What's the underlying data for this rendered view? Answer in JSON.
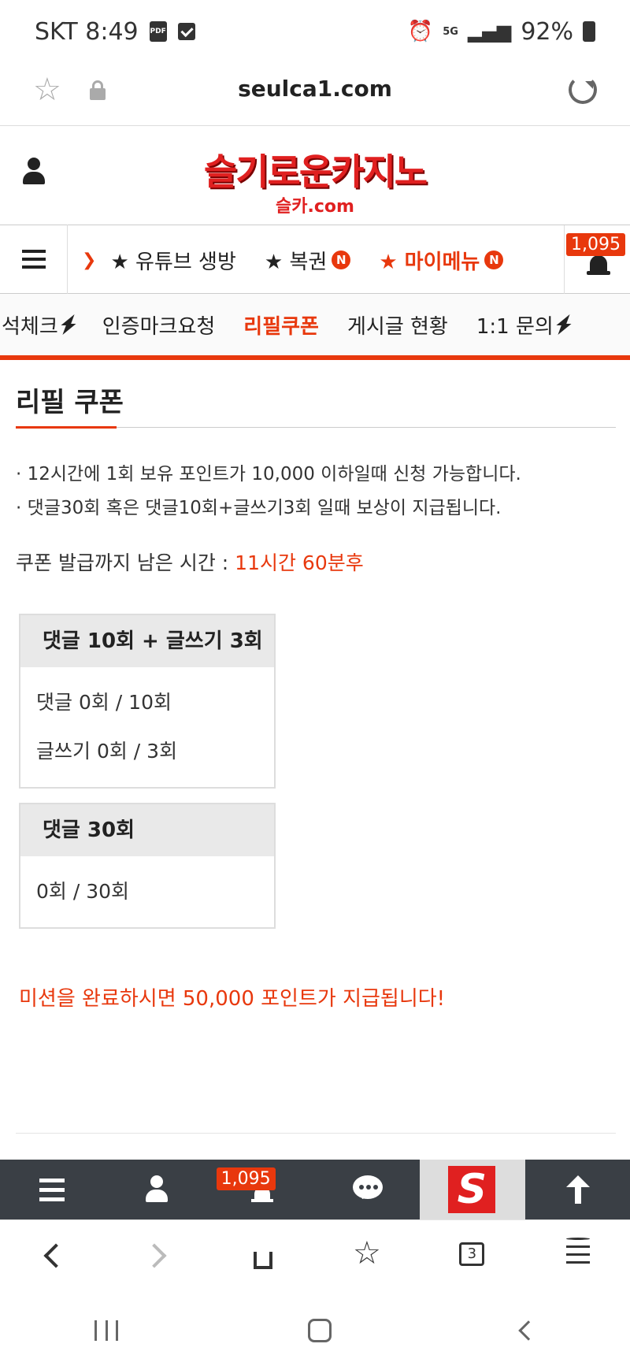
{
  "status_bar": {
    "carrier_time": "SKT 8:49",
    "pdf_icon_text": "PDF",
    "network": "5G",
    "battery": "92%"
  },
  "browser": {
    "url": "seulca1.com",
    "tab_count": "3"
  },
  "site": {
    "logo_main": "슬기로운카지노",
    "logo_sub": "슬카.com",
    "notification_count": "1,095"
  },
  "nav_primary": {
    "items": [
      {
        "label": "★ 유튜브 생방",
        "badge": ""
      },
      {
        "label": "★ 복권",
        "badge": "N"
      },
      {
        "label": "★ 마이메뉴",
        "badge": "N"
      }
    ]
  },
  "nav_secondary": {
    "items": [
      {
        "label": "석체크"
      },
      {
        "label": "인증마크요청"
      },
      {
        "label": "리필쿠폰"
      },
      {
        "label": "게시글 현황"
      },
      {
        "label": "1:1 문의"
      }
    ]
  },
  "page": {
    "title": "리필 쿠폰",
    "notes": [
      "· 12시간에 1회 보유 포인트가 10,000 이하일때 신청 가능합니다.",
      "· 댓글30회 혹은 댓글10회+글쓰기3회 일때 보상이 지급됩니다."
    ],
    "remain_label": "쿠폰 발급까지 남은 시간 : ",
    "remain_time": "11시간 60분후",
    "missions": [
      {
        "title": "댓글 10회 + 글쓰기 3회",
        "rows": [
          "댓글 0회 / 10회",
          "글쓰기 0회 / 3회"
        ]
      },
      {
        "title": "댓글 30회",
        "rows": [
          "0회 / 30회"
        ]
      }
    ],
    "reward_text": "미션을 완료하시면 50,000 포인트가 지급됩니다!"
  },
  "bottom_bar": {
    "logo_letter": "S"
  },
  "colors": {
    "accent": "#e8380d",
    "bottom_bar": "#3a3f45"
  }
}
